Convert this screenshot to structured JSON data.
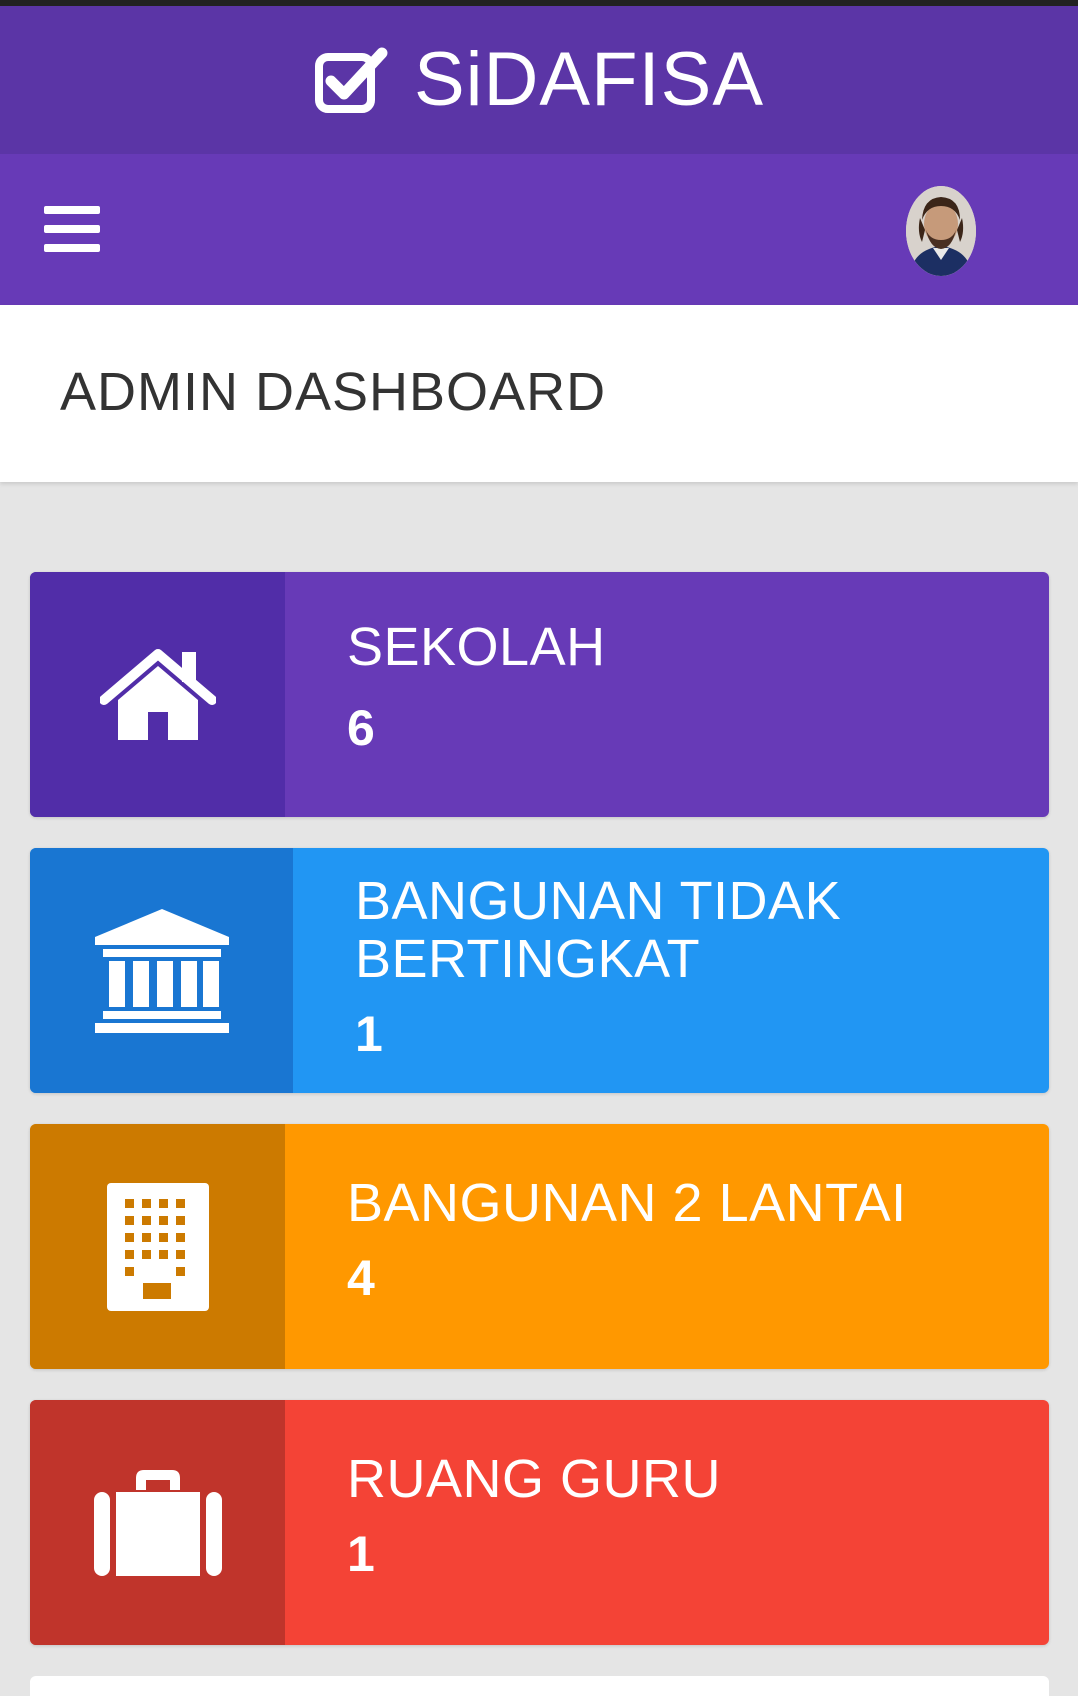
{
  "app": {
    "title": "SiDAFISA"
  },
  "page": {
    "title": "ADMIN DASHBOARD"
  },
  "cards": [
    {
      "label": "SEKOLAH",
      "count": "6",
      "icon": "home-icon",
      "accent": "#673ab7",
      "icon_bg": "#512da8"
    },
    {
      "label": "BANGUNAN TIDAK BERTINGKAT",
      "count": "1",
      "icon": "institution-icon",
      "accent": "#2196f3",
      "icon_bg": "#1976d2"
    },
    {
      "label": "BANGUNAN 2 LANTAI",
      "count": "4",
      "icon": "building-icon",
      "accent": "#ff9800",
      "icon_bg": "#cc7a00"
    },
    {
      "label": "RUANG GURU",
      "count": "1",
      "icon": "briefcase-icon",
      "accent": "#f44336",
      "icon_bg": "#c0342b"
    }
  ],
  "colors": {
    "brand_bar": "#5b35a6",
    "nav_bar": "#673ab7",
    "background": "#e5e5e5"
  }
}
